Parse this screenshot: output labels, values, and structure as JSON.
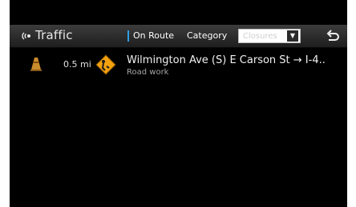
{
  "header": {
    "title": "Traffic",
    "filter_on_route": "On Route",
    "category_label": "Category",
    "category_value": "Closures",
    "dropdown_arrow": "▼"
  },
  "incidents": [
    {
      "distance": "0.5 mi",
      "road": "Wilmington Ave (S) E Carson St → I-4..",
      "event": "Road work"
    }
  ],
  "colors": {
    "accent": "#2f9fe4",
    "background": "#000000",
    "header": "#2f2f2f"
  },
  "icons": {
    "source": "traffic-source-icon",
    "incident": "traffic-cone-icon",
    "sign": "warning-sign-icon",
    "back": "back-arrow-icon"
  }
}
